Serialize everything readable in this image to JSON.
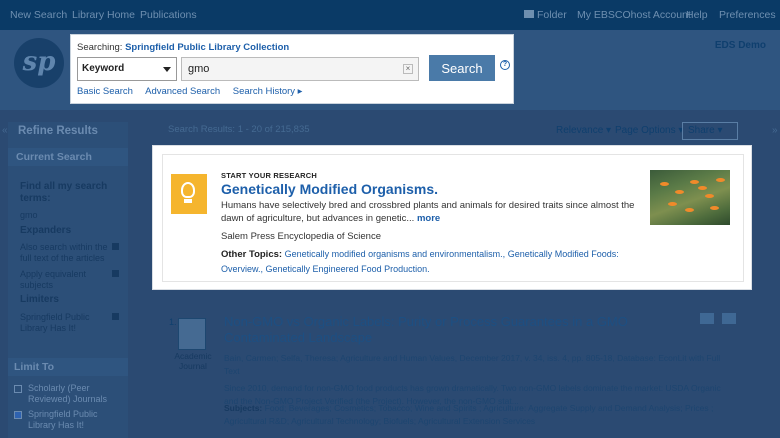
{
  "topnav": {
    "new_search": "New Search",
    "library_home": "Library Home",
    "publications": "Publications",
    "folder": "Folder",
    "my_account": "My EBSCOhost Account",
    "help": "Help",
    "preferences": "Preferences"
  },
  "header": {
    "logo_text": "sp",
    "eds_label": "EDS Demo"
  },
  "search": {
    "searching_label": "Searching:",
    "collection": "Springfield Public Library Collection",
    "field": "Keyword",
    "query": "gmo",
    "button": "Search",
    "basic_search": "Basic Search",
    "advanced_search": "Advanced Search",
    "search_history": "Search History ▸"
  },
  "sidebar": {
    "refine_title": "Refine Results",
    "current_search": "Current Search",
    "find_all": "Find all my search terms:",
    "term": "gmo",
    "expanders": "Expanders",
    "expander1": "Also search within the full text of the articles",
    "expander2": "Apply equivalent subjects",
    "limiters": "Limiters",
    "limiter1": "Springfield Public Library Has It!",
    "limit_to": "Limit To",
    "limit1": "Scholarly (Peer Reviewed) Journals",
    "limit2": "Springfield Public Library Has It!"
  },
  "results_bar": {
    "count": "Search Results: 1 - 20 of 215,835",
    "relevance": "Relevance ▾",
    "page_options": "Page Options ▾",
    "share": "Share ▾"
  },
  "research_panel": {
    "start": "START YOUR RESEARCH",
    "topic": "Genetically Modified Organisms.",
    "description": "Humans have selectively bred and crossbred plants and animals for desired traits since almost the dawn of agriculture, but advances in genetic...",
    "more": "more",
    "source": "Salem Press Encyclopedia of Science",
    "other_label": "Other Topics:",
    "other1": "Genetically modified organisms and environmentalism.,",
    "other2": "Genetically Modified Foods: Overview.,",
    "other3": "Genetically Engineered Food Production."
  },
  "result1": {
    "number": "1.",
    "type": "Academic Journal",
    "title": "Non-GMO vs Organic Labels: Purity or Process Guarantees in a GMO Contaminated Landscape",
    "meta": "Bain, Carmen; Selfa, Theresa; Agriculture and Human Values, December 2017, v. 34, iss. 4, pp. 805-18, Database: EconLit with Full Text",
    "abstract": "Since 2010, demand for non-GMO food products has grown dramatically. Two non-GMO labels dominate the market: USDA Organic and the Non-GMO Project Verified (the Project). However, the non-GMO stat...",
    "subjects_label": "Subjects:",
    "subjects": "Food; Beverages; Cosmetics; Tobacco; Wine and Spirits ; Agriculture: Aggregate Supply and Demand Analysis; Prices ; Agricultural R&D; Agricultural Technology; Biofuels; Agricultural Extension Services"
  },
  "colors": {
    "accent": "#1d5faa",
    "bulb_tile": "#f5b52e",
    "search_button": "#4a7aa8"
  }
}
